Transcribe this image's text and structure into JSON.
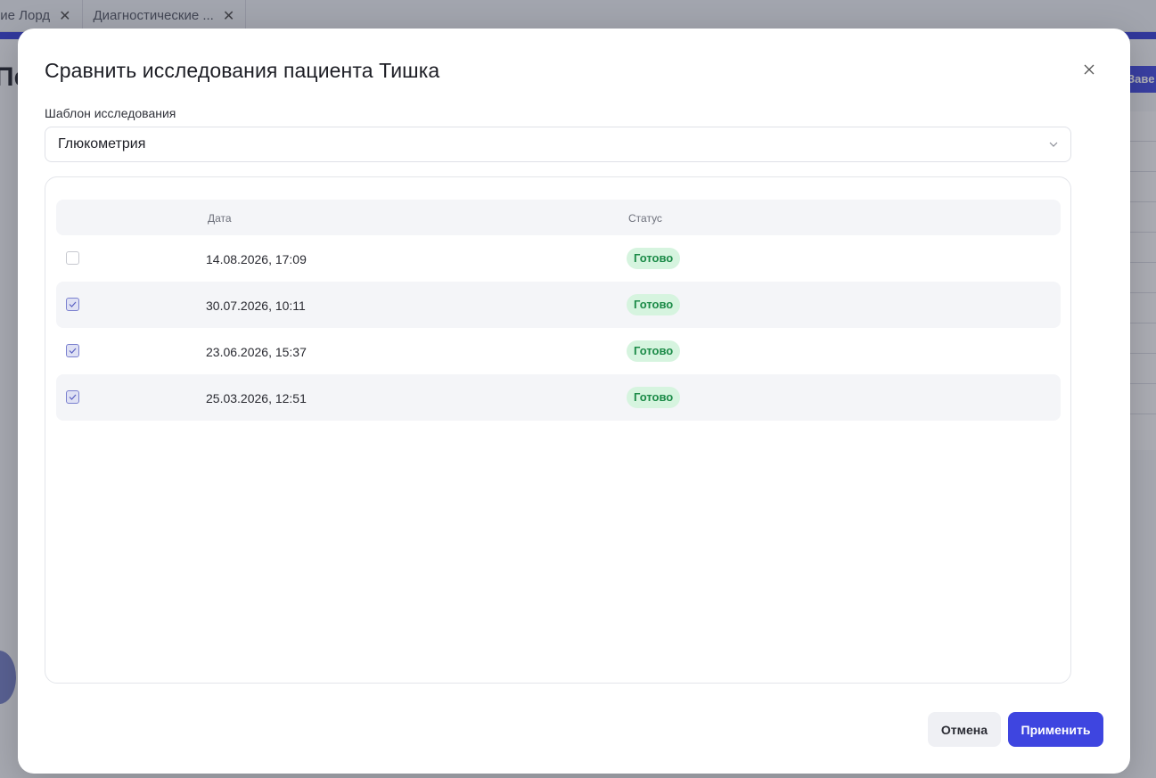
{
  "background": {
    "tabs": [
      {
        "label": "ние Лорд"
      },
      {
        "label": "Диагностические ..."
      }
    ],
    "page_title_fragment": "Пе",
    "header_button_fragment": "Заве"
  },
  "modal": {
    "title": "Сравнить исследования пациента Тишка",
    "template_label": "Шаблон исследования",
    "template_value": "Глюкометрия",
    "table": {
      "headers": {
        "date": "Дата",
        "status": "Статус"
      },
      "rows": [
        {
          "date": "14.08.2026, 17:09",
          "status": "Готово",
          "checked": false
        },
        {
          "date": "30.07.2026, 10:11",
          "status": "Готово",
          "checked": true
        },
        {
          "date": "23.06.2026, 15:37",
          "status": "Готово",
          "checked": true
        },
        {
          "date": "25.03.2026, 12:51",
          "status": "Готово",
          "checked": true
        }
      ]
    },
    "buttons": {
      "cancel": "Отмена",
      "apply": "Применить"
    }
  },
  "colors": {
    "accent": "#3e45e0",
    "status_ready_bg": "#d6f4df",
    "status_ready_text": "#1c8b48"
  }
}
